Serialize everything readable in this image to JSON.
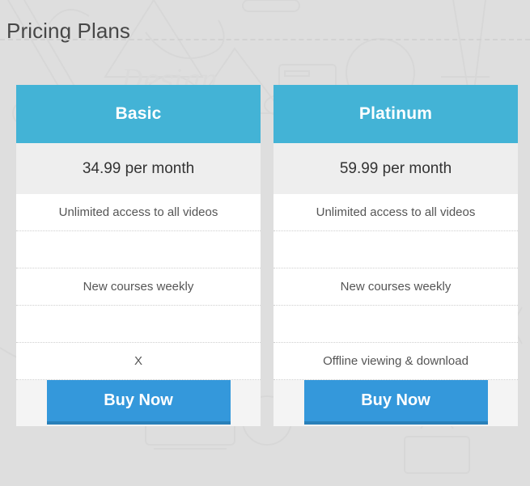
{
  "page": {
    "title": "Pricing Plans",
    "background_color": "#dedede",
    "title_color": "#474747"
  },
  "theme": {
    "header_color": "#43b3d6",
    "price_row_color": "#eeeeee",
    "card_background": "#ffffff",
    "footer_color": "#f4f4f4",
    "button_color": "#3498db",
    "button_shadow_color": "#2980b9",
    "divider_color": "#cfcfcf"
  },
  "plans": [
    {
      "name": "Basic",
      "price": "34.99 per month",
      "features": [
        "Unlimited access to all videos",
        "",
        "New courses weekly",
        "",
        "X"
      ],
      "cta_label": "Buy Now"
    },
    {
      "name": "Platinum",
      "price": "59.99 per month",
      "features": [
        "Unlimited access to all videos",
        "",
        "New courses weekly",
        "",
        "Offline viewing & download"
      ],
      "cta_label": "Buy Now"
    }
  ]
}
